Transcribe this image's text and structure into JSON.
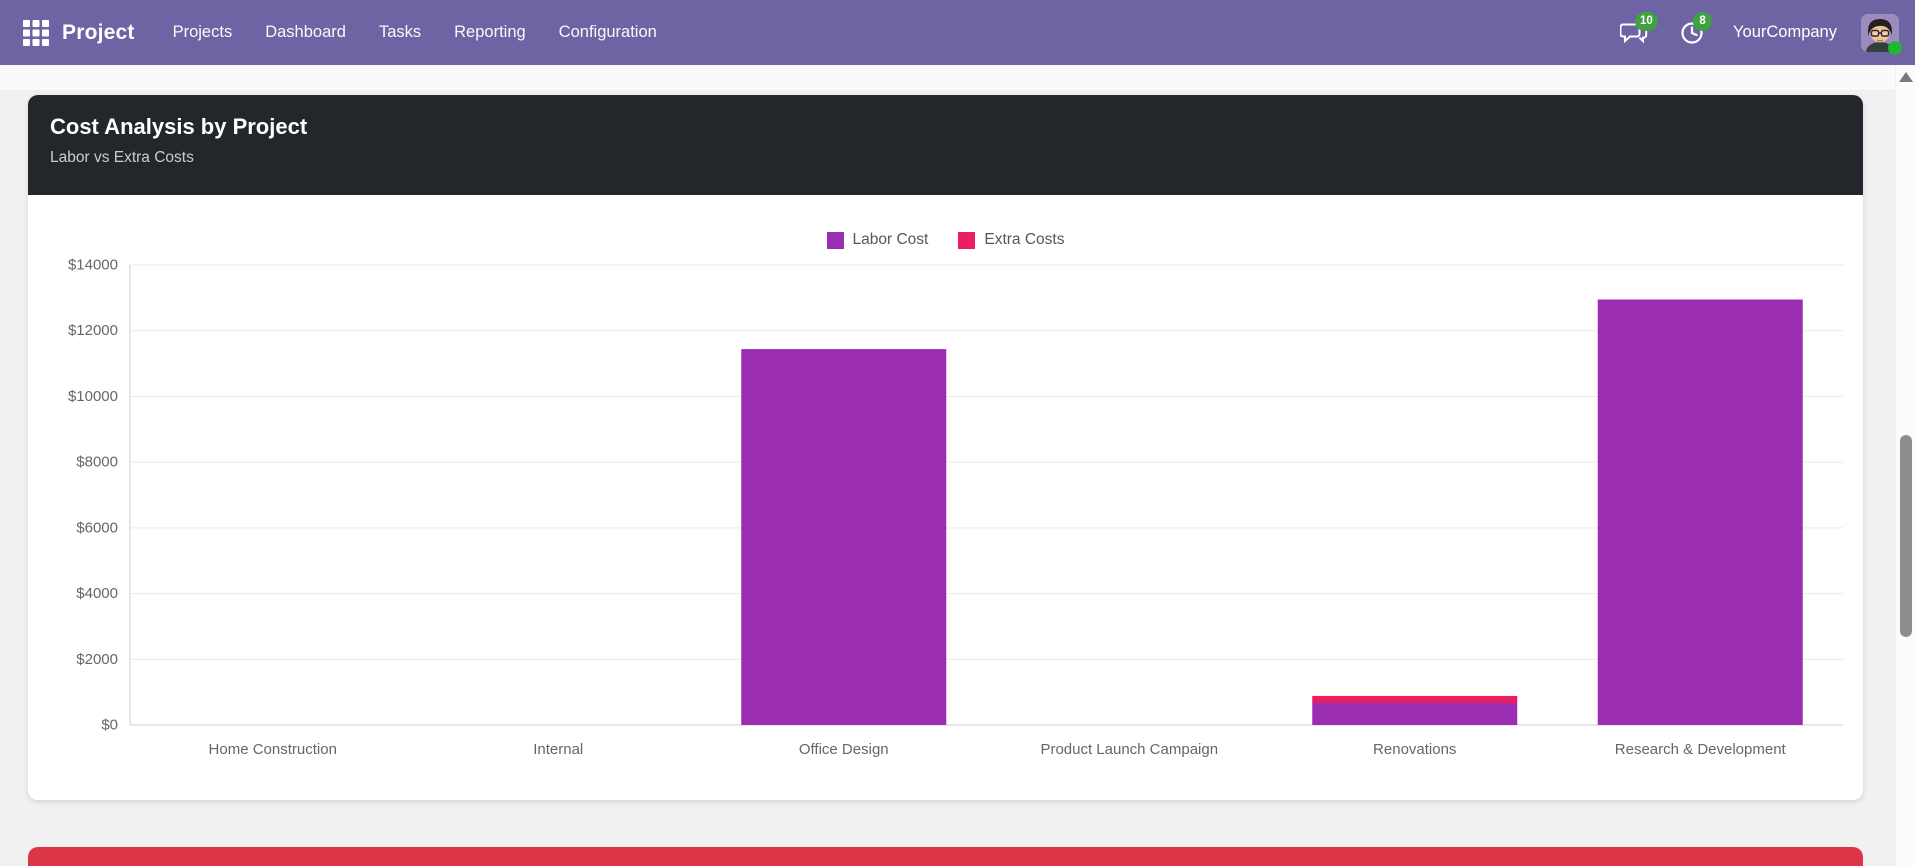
{
  "nav": {
    "app_name": "Project",
    "menu_items": [
      "Projects",
      "Dashboard",
      "Tasks",
      "Reporting",
      "Configuration"
    ],
    "messages_badge": "10",
    "activities_badge": "8",
    "company_name": "YourCompany"
  },
  "chart_card": {
    "title": "Cost Analysis by Project",
    "subtitle": "Labor vs Extra Costs"
  },
  "chart_data": {
    "type": "bar",
    "stacked": true,
    "title": "Cost Analysis by Project",
    "subtitle": "Labor vs Extra Costs",
    "categories": [
      "Home Construction",
      "Internal",
      "Office Design",
      "Product Launch Campaign",
      "Renovations",
      "Research & Development"
    ],
    "series": [
      {
        "name": "Labor Cost",
        "color": "#9b2db3",
        "values": [
          0,
          0,
          11440,
          0,
          670,
          12950
        ]
      },
      {
        "name": "Extra Costs",
        "color": "#e91e63",
        "values": [
          0,
          0,
          0,
          0,
          215,
          0
        ]
      }
    ],
    "xlabel": "",
    "ylabel": "",
    "ylim": [
      0,
      14000
    ],
    "ytick_step": 2000,
    "ytick_prefix": "$",
    "legend_position": "top",
    "grid": true
  },
  "colors": {
    "navbar": "#6e64a3",
    "card_header": "#23272c",
    "badge_green": "#3fa142",
    "bottom_bar_red": "#dc3545"
  }
}
